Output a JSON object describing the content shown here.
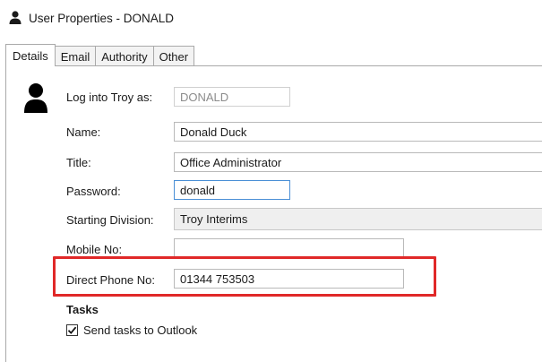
{
  "window": {
    "title": "User Properties - DONALD",
    "icon": "user-icon"
  },
  "tabs": [
    {
      "label": "Details",
      "active": true
    },
    {
      "label": "Email",
      "active": false
    },
    {
      "label": "Authority",
      "active": false
    },
    {
      "label": "Other",
      "active": false
    }
  ],
  "form": {
    "avatar_icon": "user-silhouette-icon",
    "login": {
      "label": "Log into Troy as:",
      "value": "DONALD"
    },
    "name": {
      "label": "Name:",
      "value": "Donald Duck"
    },
    "title": {
      "label": "Title:",
      "value": "Office Administrator"
    },
    "password": {
      "label": "Password:",
      "value": "donald"
    },
    "division": {
      "label": "Starting Division:",
      "value": "Troy Interims"
    },
    "mobile": {
      "label": "Mobile No:",
      "value": ""
    },
    "direct_phone": {
      "label": "Direct Phone No:",
      "value": "01344 753503"
    }
  },
  "tasks": {
    "heading": "Tasks",
    "send_to_outlook": {
      "label": "Send tasks to Outlook",
      "checked": true
    }
  },
  "colors": {
    "highlight": "#e02828",
    "focus_border": "#4a8fd6"
  }
}
